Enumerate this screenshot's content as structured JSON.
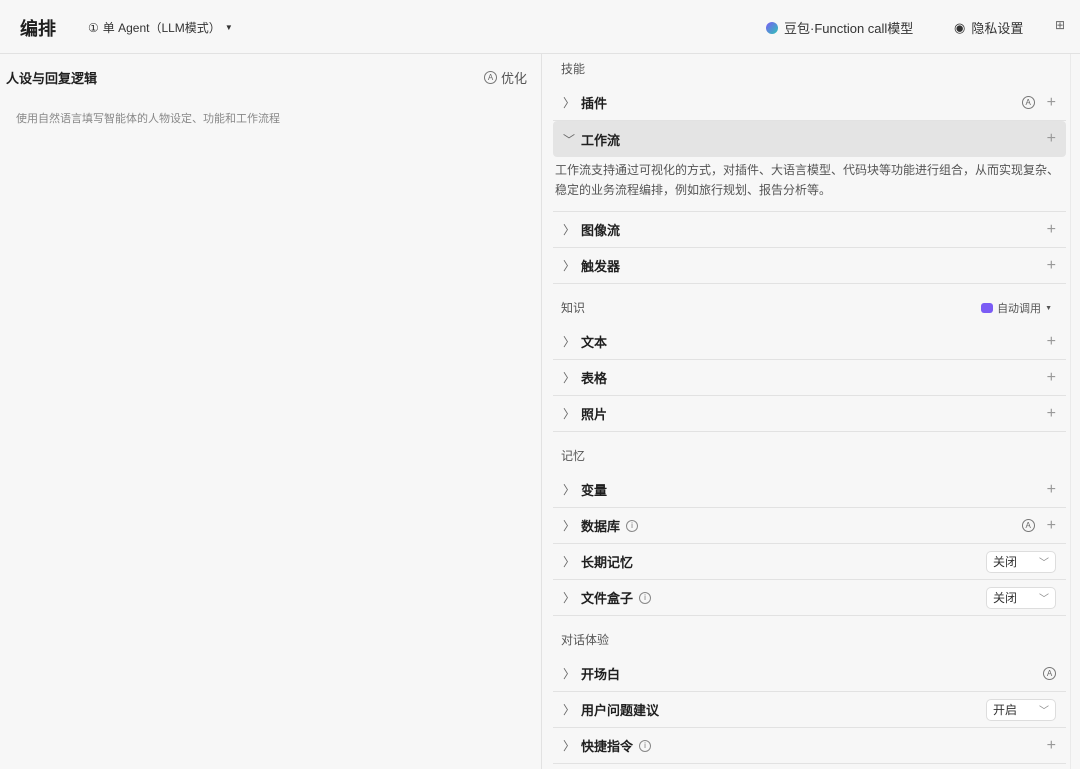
{
  "header": {
    "title": "编排",
    "mode": "单 Agent（LLM模式）",
    "model": "豆包·Function call模型",
    "privacy": "隐私设置"
  },
  "left": {
    "title": "人设与回复逻辑",
    "optimize": "优化",
    "placeholder": "使用自然语言填写智能体的人物设定、功能和工作流程"
  },
  "skills": {
    "label": "技能",
    "plugin": "插件",
    "workflow": "工作流",
    "workflow_desc": "工作流支持通过可视化的方式，对插件、大语言模型、代码块等功能进行组合，从而实现复杂、稳定的业务流程编排，例如旅行规划、报告分析等。",
    "imageflow": "图像流",
    "trigger": "触发器"
  },
  "knowledge": {
    "label": "知识",
    "auto": "自动调用",
    "text": "文本",
    "table": "表格",
    "photo": "照片"
  },
  "memory": {
    "label": "记忆",
    "variable": "变量",
    "database": "数据库",
    "longterm": "长期记忆",
    "longterm_value": "关闭",
    "filebox": "文件盒子",
    "filebox_value": "关闭"
  },
  "dialog": {
    "label": "对话体验",
    "opening": "开场白",
    "suggest": "用户问题建议",
    "suggest_value": "开启",
    "shortcut": "快捷指令"
  },
  "colors": {
    "accent": "#7b5cf5"
  }
}
